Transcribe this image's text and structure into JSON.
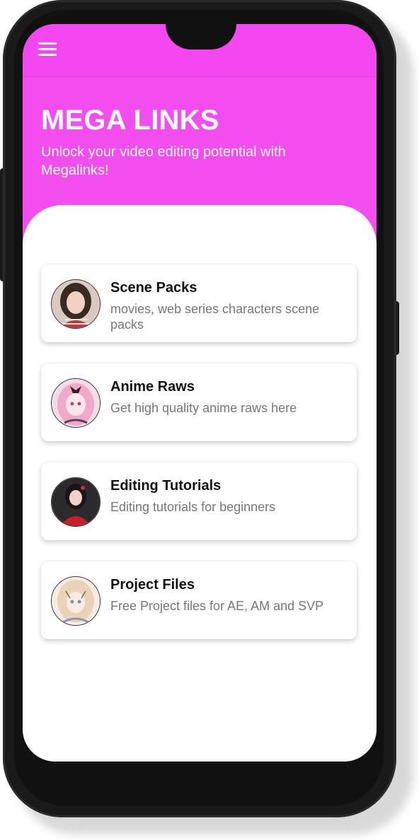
{
  "header": {
    "title": "MEGA LINKS",
    "subtitle": "Unlock your video editing potential with Megalinks!",
    "menu_icon": "hamburger-menu-icon",
    "background_color": "#f34df0"
  },
  "cards": [
    {
      "title": "Scene Packs",
      "description": "movies, web series characters scene packs",
      "avatar": "woman-portrait-avatar"
    },
    {
      "title": "Anime Raws",
      "description": "Get high quality anime raws here",
      "avatar": "anime-girl-pink-hair-avatar"
    },
    {
      "title": "Editing Tutorials",
      "description": "Editing tutorials for beginners",
      "avatar": "woman-red-dress-avatar"
    },
    {
      "title": "Project Files",
      "description": "Free Project files for AE, AM and SVP",
      "avatar": "anime-girl-blonde-avatar"
    }
  ]
}
